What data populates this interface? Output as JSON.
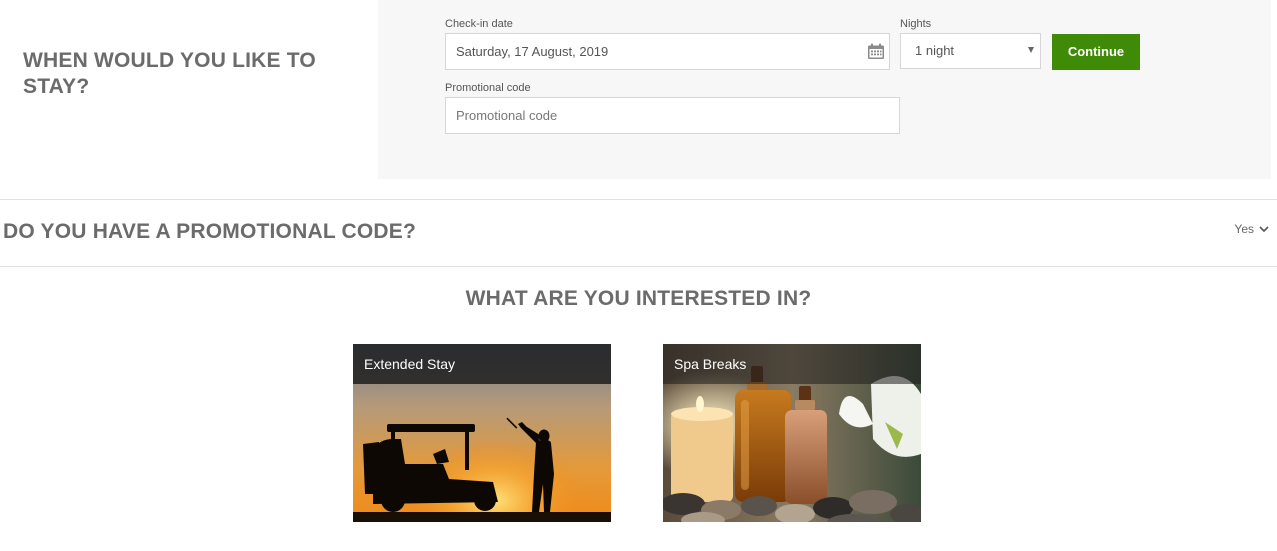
{
  "stay": {
    "heading": "WHEN WOULD YOU LIKE TO STAY?",
    "checkin_label": "Check-in date",
    "checkin_value": "Saturday, 17 August, 2019",
    "nights_label": "Nights",
    "nights_value": "1 night",
    "continue_label": "Continue",
    "promo_label": "Promotional code",
    "promo_placeholder": "Promotional code"
  },
  "promo_section": {
    "question": "DO YOU HAVE A PROMOTIONAL CODE?",
    "toggle_label": "Yes"
  },
  "interests": {
    "heading": "WHAT ARE YOU INTERESTED IN?",
    "cards": [
      {
        "title": "Extended Stay"
      },
      {
        "title": "Spa Breaks"
      }
    ]
  },
  "colors": {
    "accent_green": "#3f8a06",
    "panel_bg": "#f7f7f7",
    "heading_text": "#6b6b6b"
  },
  "icons": {
    "calendar": "calendar-icon",
    "select_caret": "caret-down-icon",
    "toggle_chevron": "chevron-down-icon"
  }
}
